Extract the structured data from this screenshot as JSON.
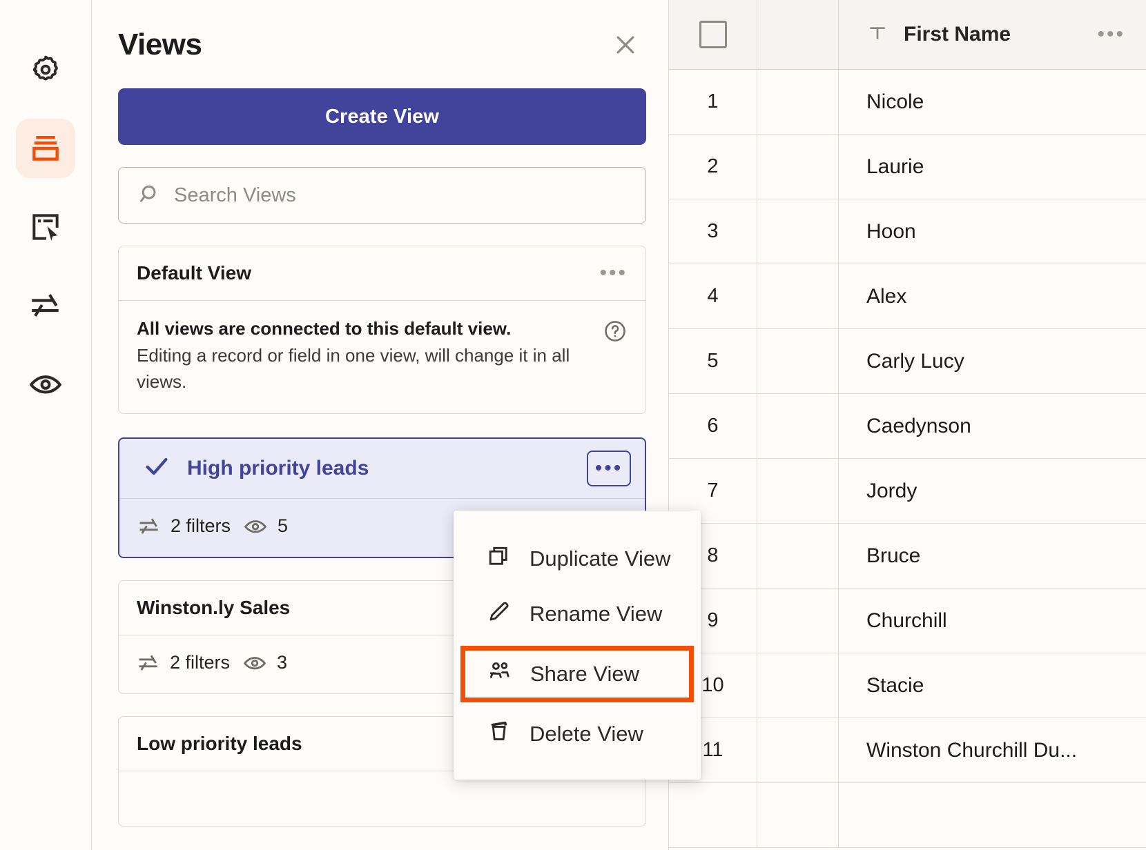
{
  "rail": {
    "items": [
      {
        "name": "settings-icon",
        "label": "Settings",
        "active": false
      },
      {
        "name": "views-icon",
        "label": "Views",
        "active": true
      },
      {
        "name": "forms-icon",
        "label": "Forms",
        "active": false
      },
      {
        "name": "filters-icon",
        "label": "Filters",
        "active": false
      },
      {
        "name": "visibility-icon",
        "label": "Hidden fields",
        "active": false
      }
    ]
  },
  "panel": {
    "title": "Views",
    "close_label": "×",
    "create_button": "Create View",
    "search": {
      "placeholder": "Search Views",
      "value": ""
    },
    "default_card": {
      "name": "Default View",
      "menu_dots": "•••",
      "notice_bold": "All views are connected to this default view.",
      "notice_text": "Editing a record or field in one view, will change it in all views."
    },
    "views": [
      {
        "name": "High priority leads",
        "selected": true,
        "filters": "2 filters",
        "fields": "5",
        "menu_dots": "•••"
      },
      {
        "name": "Winston.ly Sales",
        "selected": false,
        "filters": "2 filters",
        "fields": "3",
        "menu_dots": "•••"
      },
      {
        "name": "Low priority leads",
        "selected": false,
        "filters": "",
        "fields": "",
        "menu_dots": "•••"
      }
    ]
  },
  "context_menu": {
    "items": [
      {
        "label": "Duplicate View",
        "icon": "duplicate-icon",
        "highlighted": false
      },
      {
        "label": "Rename View",
        "icon": "pencil-icon",
        "highlighted": false
      },
      {
        "label": "Share View",
        "icon": "people-icon",
        "highlighted": true
      },
      {
        "label": "Delete View",
        "icon": "trash-icon",
        "highlighted": false
      }
    ],
    "highlight_color": "#f24e08"
  },
  "grid": {
    "header": {
      "select_all": "select-all-checkbox",
      "column_label": "First Name",
      "column_type_icon": "text-type-icon",
      "column_menu": "•••"
    },
    "rows": [
      {
        "num": "1",
        "first_name": "Nicole"
      },
      {
        "num": "2",
        "first_name": "Laurie"
      },
      {
        "num": "3",
        "first_name": "Hoon"
      },
      {
        "num": "4",
        "first_name": "Alex"
      },
      {
        "num": "5",
        "first_name": "Carly Lucy"
      },
      {
        "num": "6",
        "first_name": "Caedynson"
      },
      {
        "num": "7",
        "first_name": "Jordy"
      },
      {
        "num": "8",
        "first_name": "Bruce"
      },
      {
        "num": "9",
        "first_name": "Churchill"
      },
      {
        "num": "10",
        "first_name": "Stacie"
      },
      {
        "num": "11",
        "first_name": "Winston Churchill Du..."
      },
      {
        "num": "",
        "first_name": ""
      }
    ]
  },
  "colors": {
    "primary": "#41449a",
    "accent": "#f24e08",
    "background": "#fdfcf8",
    "selected_bg": "#ebebf7"
  }
}
